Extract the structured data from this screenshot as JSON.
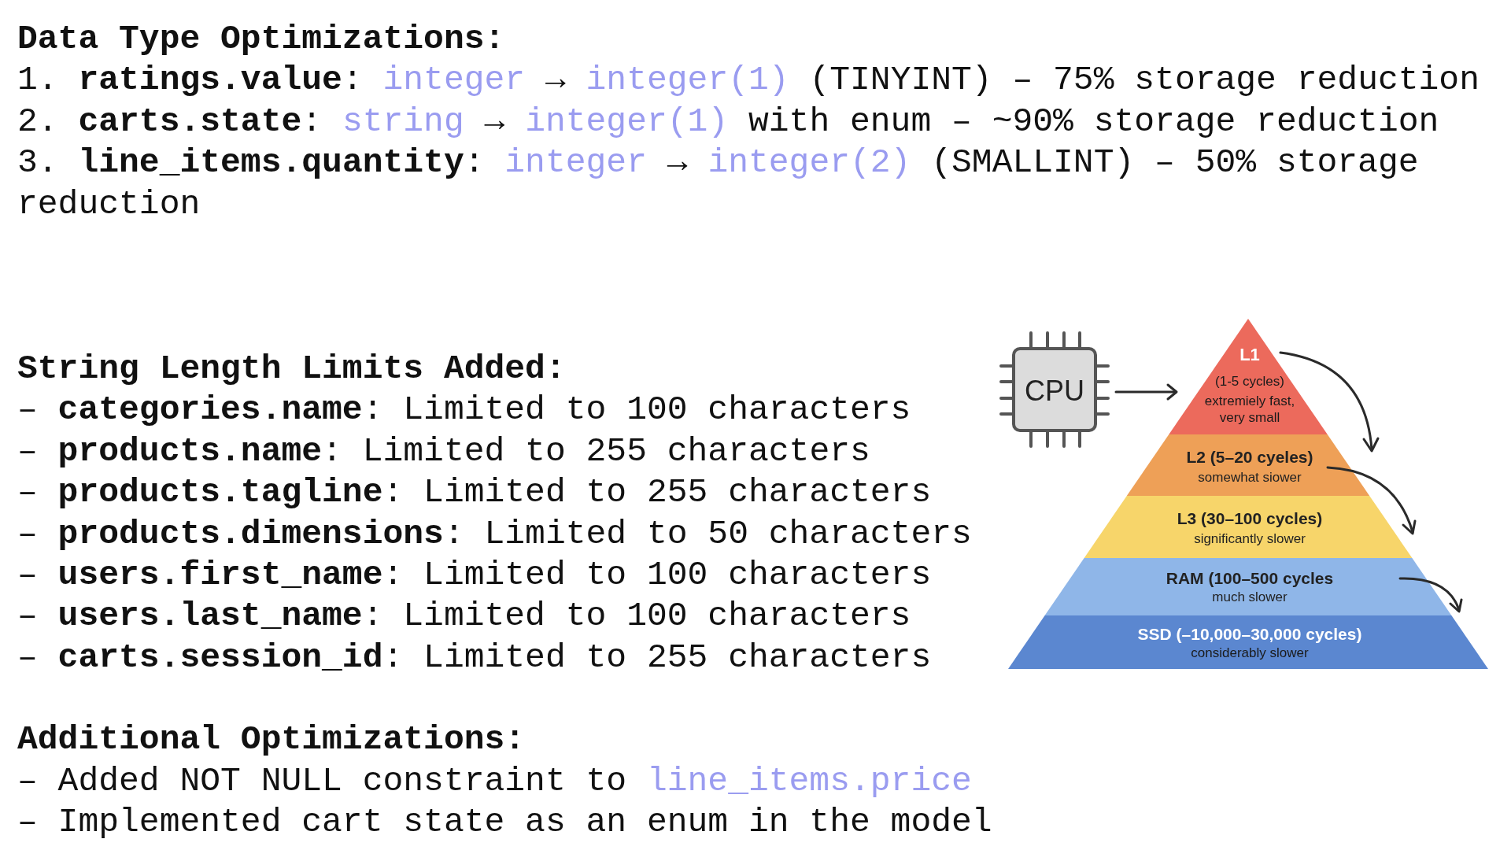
{
  "sections": [
    {
      "heading": "Data Type Optimizations:",
      "lines": [
        [
          {
            "kind": "plain",
            "text": "1. "
          },
          {
            "kind": "bold",
            "text": "ratings.value"
          },
          {
            "kind": "plain",
            "text": ": "
          },
          {
            "kind": "code",
            "text": "integer"
          },
          {
            "kind": "plain",
            "text": " → "
          },
          {
            "kind": "code",
            "text": "integer(1)"
          },
          {
            "kind": "plain",
            "text": " (TINYINT) – 75% storage reduction"
          }
        ],
        [
          {
            "kind": "plain",
            "text": "2. "
          },
          {
            "kind": "bold",
            "text": "carts.state"
          },
          {
            "kind": "plain",
            "text": ": "
          },
          {
            "kind": "code",
            "text": "string"
          },
          {
            "kind": "plain",
            "text": " → "
          },
          {
            "kind": "code",
            "text": "integer(1)"
          },
          {
            "kind": "plain",
            "text": " with enum – ~90% storage reduction"
          }
        ],
        [
          {
            "kind": "plain",
            "text": "3. "
          },
          {
            "kind": "bold",
            "text": "line_items.quantity"
          },
          {
            "kind": "plain",
            "text": ": "
          },
          {
            "kind": "code",
            "text": "integer"
          },
          {
            "kind": "plain",
            "text": " → "
          },
          {
            "kind": "code",
            "text": "integer(2)"
          },
          {
            "kind": "plain",
            "text": " (SMALLINT) – 50% storage reduction"
          }
        ]
      ]
    },
    {
      "heading": "String Length Limits Added:",
      "lines": [
        [
          {
            "kind": "plain",
            "text": "– "
          },
          {
            "kind": "bold",
            "text": "categories.name"
          },
          {
            "kind": "plain",
            "text": ": Limited to 100 characters"
          }
        ],
        [
          {
            "kind": "plain",
            "text": "– "
          },
          {
            "kind": "bold",
            "text": "products.name"
          },
          {
            "kind": "plain",
            "text": ": Limited to 255 characters"
          }
        ],
        [
          {
            "kind": "plain",
            "text": "– "
          },
          {
            "kind": "bold",
            "text": "products.tagline"
          },
          {
            "kind": "plain",
            "text": ": Limited to 255 characters"
          }
        ],
        [
          {
            "kind": "plain",
            "text": "– "
          },
          {
            "kind": "bold",
            "text": "products.dimensions"
          },
          {
            "kind": "plain",
            "text": ": Limited to 50 characters"
          }
        ],
        [
          {
            "kind": "plain",
            "text": "– "
          },
          {
            "kind": "bold",
            "text": "users.first_name"
          },
          {
            "kind": "plain",
            "text": ": Limited to 100 characters"
          }
        ],
        [
          {
            "kind": "plain",
            "text": "– "
          },
          {
            "kind": "bold",
            "text": "users.last_name"
          },
          {
            "kind": "plain",
            "text": ": Limited to 100 characters"
          }
        ],
        [
          {
            "kind": "plain",
            "text": "– "
          },
          {
            "kind": "bold",
            "text": "carts.session_id"
          },
          {
            "kind": "plain",
            "text": ": Limited to 255 characters"
          }
        ]
      ]
    },
    {
      "heading": "Additional Optimizations:",
      "lines": [
        [
          {
            "kind": "plain",
            "text": "– Added NOT NULL constraint to "
          },
          {
            "kind": "code",
            "text": "line_items.price"
          }
        ],
        [
          {
            "kind": "plain",
            "text": "– Implemented cart state as an enum in the model"
          }
        ]
      ]
    }
  ],
  "diagram": {
    "chip_label": "CPU",
    "tiers": [
      {
        "title": "L1",
        "captions": [
          "(1-5 cycles)",
          "extremiely fast,",
          "very small"
        ],
        "color": "#ec6a5c"
      },
      {
        "title": "L2 (5–20 cyeles)",
        "captions": [
          "somewhat siower"
        ],
        "color": "#eea057"
      },
      {
        "title": "L3 (30–100 cycles)",
        "captions": [
          "significantly slower"
        ],
        "color": "#f7d56a"
      },
      {
        "title": "RAM (100–500 cycles",
        "captions": [
          "much slower"
        ],
        "color": "#8fb6e8"
      },
      {
        "title": "SSD (–10,000–30,000 cycles)",
        "captions": [
          "considerably slower"
        ],
        "color": "#5b87d0"
      }
    ]
  }
}
